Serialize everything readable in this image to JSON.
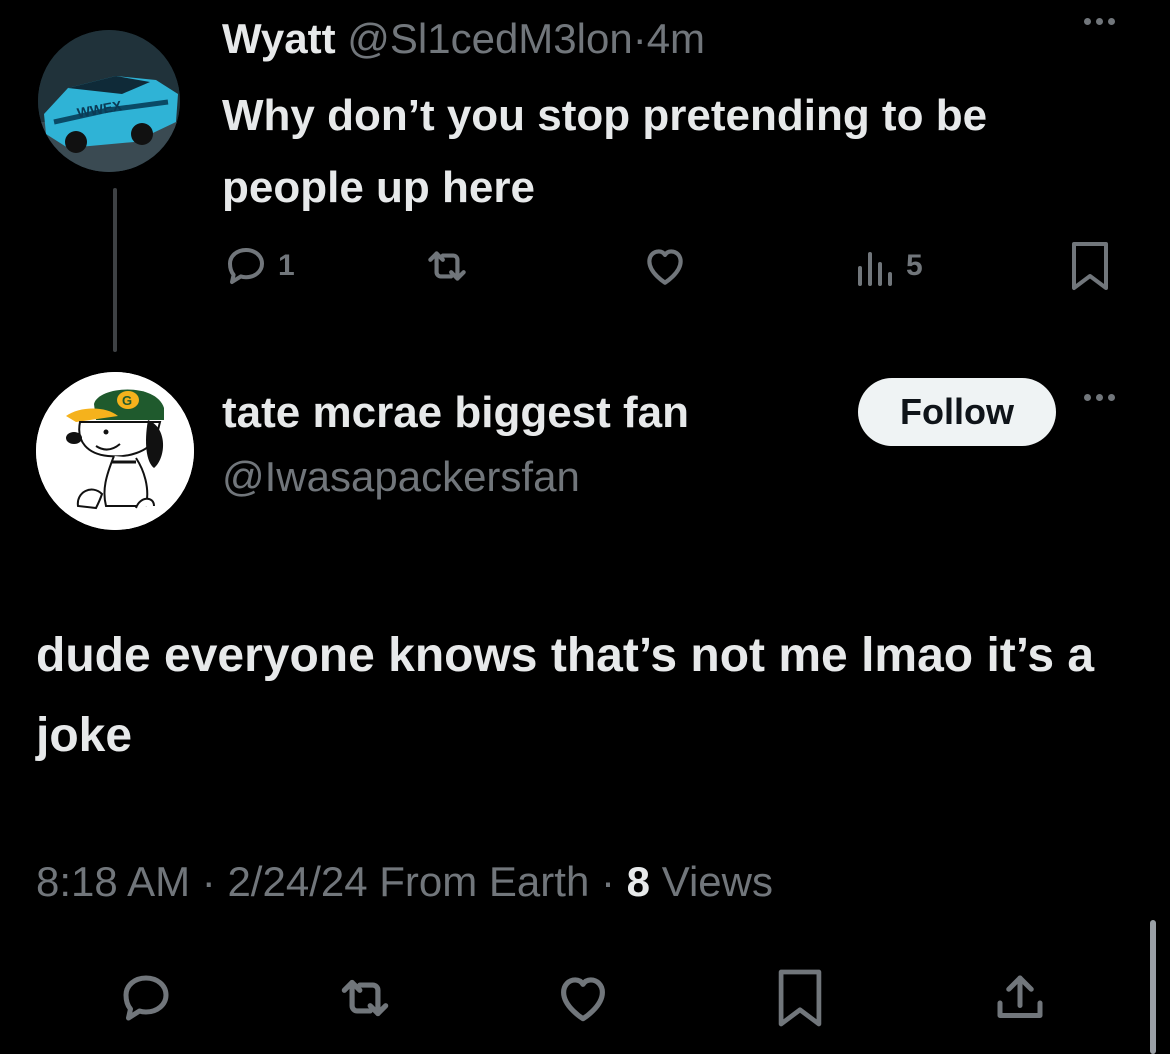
{
  "parent_tweet": {
    "author_name": "Wyatt",
    "handle": "@Sl1cedM3lon",
    "separator": "·",
    "time": "4m",
    "text": "Why don’t you stop pretending to be people up here",
    "avatar_icon": "race-car-avatar",
    "actions": {
      "reply_count": "1",
      "retweet_count": "",
      "like_count": "",
      "views_count": "5"
    }
  },
  "main_tweet": {
    "author_name": "tate mcrae biggest fan",
    "handle": "@Iwasapackersfan",
    "follow_label": "Follow",
    "avatar_icon": "snoopy-packers-cap-avatar",
    "text": "dude everyone knows that’s not me lmao it’s a joke",
    "time": "8:18 AM",
    "separator": "·",
    "date": "2/24/24",
    "location": "From Earth",
    "views_count": "8",
    "views_label": "Views"
  },
  "colors": {
    "background": "#000000",
    "text_primary": "#e7e9ea",
    "text_secondary": "#71767b",
    "follow_button_bg": "#eff3f4"
  }
}
